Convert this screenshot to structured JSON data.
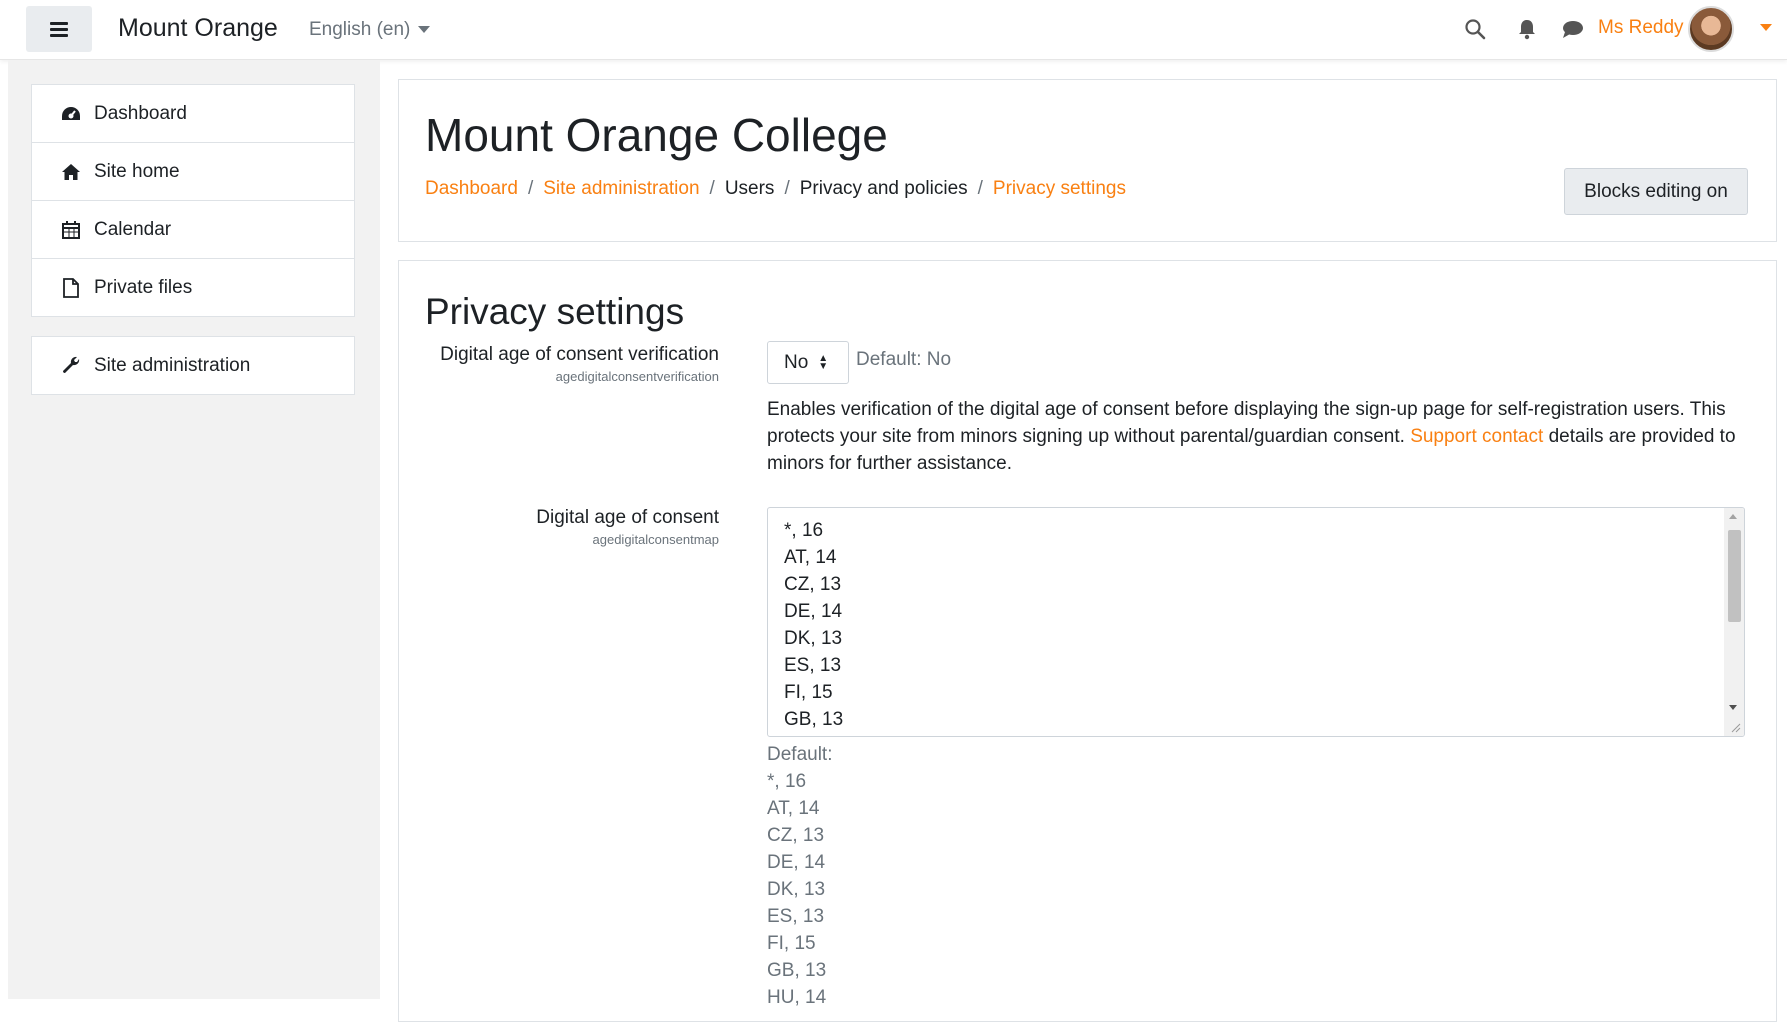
{
  "navbar": {
    "site_name": "Mount Orange",
    "language": "English (en)",
    "user_name": "Ms Reddy",
    "icons": [
      "menu-icon",
      "search-icon",
      "bell-icon",
      "chat-icon",
      "chevron-down-icon"
    ]
  },
  "drawer": {
    "items": [
      {
        "label": "Dashboard",
        "icon": "dashboard-icon"
      },
      {
        "label": "Site home",
        "icon": "home-icon"
      },
      {
        "label": "Calendar",
        "icon": "calendar-icon"
      },
      {
        "label": "Private files",
        "icon": "file-icon"
      }
    ],
    "admin_item": {
      "label": "Site administration",
      "icon": "wrench-icon"
    }
  },
  "header": {
    "title": "Mount Orange College",
    "breadcrumb": [
      "Dashboard",
      "Site administration",
      "Users",
      "Privacy and policies",
      "Privacy settings"
    ],
    "separator": "/",
    "blocks_button": "Blocks editing on"
  },
  "settings": {
    "section_title": "Privacy settings",
    "verification": {
      "label": "Digital age of consent verification",
      "name": "agedigitalconsentverification",
      "value": "No",
      "default": "Default: No",
      "description_before": "Enables verification of the digital age of consent before displaying the sign-up page for self-registration users. This protects your site from minors signing up without parental/guardian consent.",
      "description_link": "Support contact",
      "description_after": "details are provided to minors for further assistance."
    },
    "consent_map": {
      "label": "Digital age of consent",
      "name": "agedigitalconsentmap",
      "lines": [
        "*, 16",
        "AT, 14",
        "CZ, 13",
        "DE, 14",
        "DK, 13",
        "ES, 13",
        "FI, 15",
        "GB, 13"
      ],
      "default_label": "Default:",
      "default_lines": [
        "*, 16",
        "AT, 14",
        "CZ, 13",
        "DE, 14",
        "DK, 13",
        "ES, 13",
        "FI, 15",
        "GB, 13",
        "HU, 14"
      ]
    }
  },
  "colors": {
    "accent": "#f98012",
    "text": "#1d2125",
    "muted": "#6a737b",
    "drawer_bg": "#f2f2f2"
  }
}
